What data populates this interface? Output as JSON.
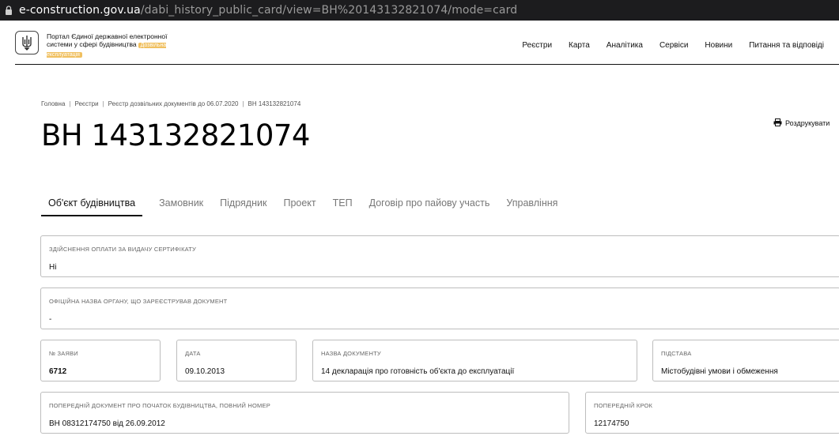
{
  "browser": {
    "url_domain": "e-construction.gov.ua",
    "url_path": "/dabi_history_public_card/view=ВН%20143132821074/mode=card"
  },
  "site": {
    "brand_text": "Портал Єдиної державної електронної системи у сфері будівництва",
    "badge": "Дозвільна експлуатація",
    "nav": [
      "Реєстри",
      "Карта",
      "Аналітика",
      "Сервіси",
      "Новини",
      "Питання та відповіді"
    ]
  },
  "breadcrumbs": [
    "Головна",
    "Реєстри",
    "Реєстр дозвільних документів до 06.07.2020",
    "ВН 143132821074"
  ],
  "page": {
    "title": "ВН 143132821074",
    "print_label": "Роздрукувати"
  },
  "tabs": [
    "Об'єкт будівництва",
    "Замовник",
    "Підрядник",
    "Проект",
    "ТЕП",
    "Договір про пайову участь",
    "Управління"
  ],
  "fields": {
    "payment": {
      "label": "Здійснення оплати за видачу сертифікату",
      "value": "Ні"
    },
    "authority": {
      "label": "Офіційна назва органу, що зареєстрував документ",
      "value": "-"
    },
    "app_no": {
      "label": "№ заяви",
      "value": "6712"
    },
    "date": {
      "label": "Дата",
      "value": "09.10.2013"
    },
    "doc_name": {
      "label": "Назва документу",
      "value": "14 декларація про готовність об'єкта до експлуатації"
    },
    "basis": {
      "label": "Підстава",
      "value": "Містобудівні умови і обмеження"
    },
    "prev_doc": {
      "label": "Попередній документ про початок будівництва, повний номер",
      "value": "ВН 08312174750 від 26.09.2012"
    },
    "prev_step": {
      "label": "Попередній крок",
      "value": "12174750"
    }
  }
}
